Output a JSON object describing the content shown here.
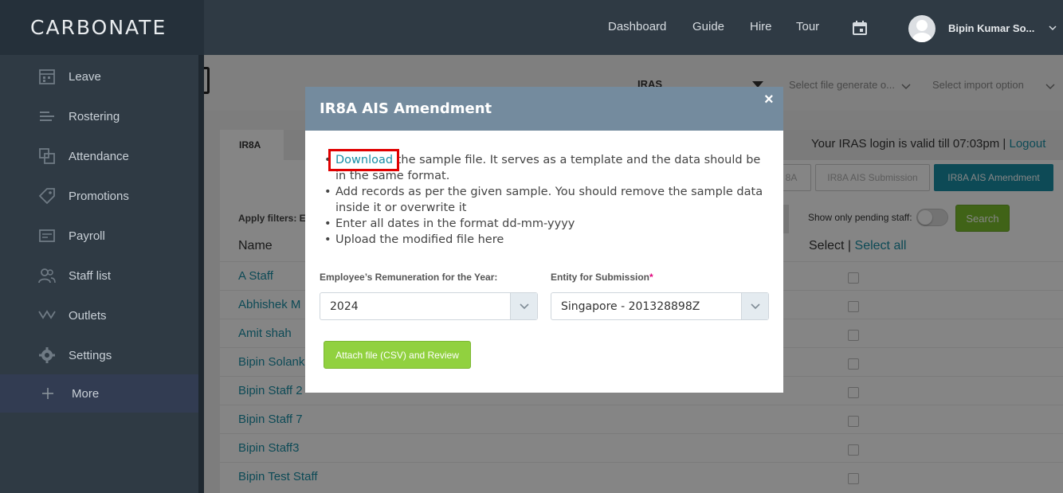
{
  "app": {
    "logo": "CARBONATE"
  },
  "topnav": {
    "items": [
      {
        "label": "Dashboard"
      },
      {
        "label": "Guide"
      },
      {
        "label": "Hire"
      },
      {
        "label": "Tour"
      }
    ],
    "calendar_icon": "calendar-icon",
    "user_name": "Bipin Kumar So..."
  },
  "sidebar": {
    "items": [
      {
        "label": "Leave",
        "icon": "calendar-grid-icon"
      },
      {
        "label": "Rostering",
        "icon": "roster-icon"
      },
      {
        "label": "Attendance",
        "icon": "attendance-icon"
      },
      {
        "label": "Promotions",
        "icon": "tag-icon"
      },
      {
        "label": "Payroll",
        "icon": "payroll-icon"
      },
      {
        "label": "Staff list",
        "icon": "users-icon"
      },
      {
        "label": "Outlets",
        "icon": "outlets-icon"
      },
      {
        "label": "Settings",
        "icon": "gear-icon"
      }
    ],
    "more": {
      "label": "More",
      "icon": "plus-icon"
    }
  },
  "filters": {
    "iras_select": "IRAS",
    "file_generate_placeholder": "Select file generate o...",
    "import_placeholder": "Select import option"
  },
  "page": {
    "tab_label": "IR8A",
    "iras_login_text": "Your IRAS login is valid till 07:03pm |",
    "logout_label": "Logout",
    "buttons": [
      {
        "label": "8A"
      },
      {
        "label": "IR8A AIS Submission"
      },
      {
        "label": "IR8A AIS Amendment"
      }
    ],
    "apply_filters_label": "Apply filters: E",
    "pending_label": "Show only pending staff:",
    "search_label": "Search",
    "col_name": "Name",
    "col_select_label": "Select |",
    "select_all_label": "Select all",
    "rows": [
      {
        "name": "A Staff"
      },
      {
        "name": "Abhishek M"
      },
      {
        "name": "Amit shah"
      },
      {
        "name": "Bipin Solank"
      },
      {
        "name": "Bipin Staff 2"
      },
      {
        "name": "Bipin Staff 7"
      },
      {
        "name": "Bipin Staff3"
      },
      {
        "name": "Bipin Test Staff"
      }
    ]
  },
  "modal": {
    "title": "IR8A AIS Amendment",
    "close_symbol": "×",
    "instructions": {
      "download_link": "Download",
      "line1_rest": " the sample file. It serves as a template and the data should be in the same format.",
      "line2": "Add records as per the given sample. You should remove the sample data inside it or overwrite it",
      "line3": "Enter all dates in the format dd-mm-yyyy",
      "line4": "Upload the modified file here"
    },
    "year_label": "Employee’s Remuneration for the Year:",
    "year_value": "2024",
    "entity_label": "Entity for Submission",
    "entity_required": "*",
    "entity_value": "Singapore - 201328898Z",
    "attach_button": "Attach file (CSV) and Review"
  }
}
